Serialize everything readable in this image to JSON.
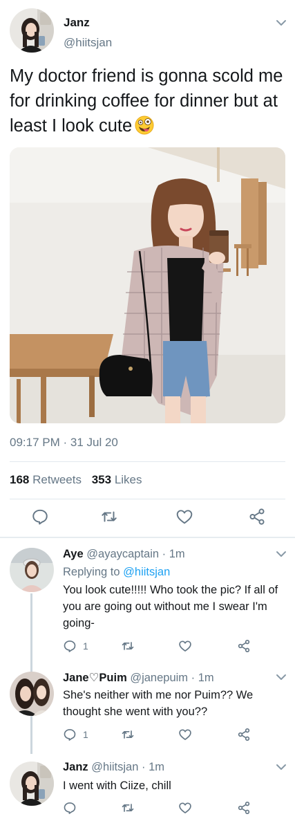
{
  "main_tweet": {
    "display_name": "Janz",
    "handle": "@hiitsjan",
    "text": "My doctor friend is gonna scold me for drinking coffee for dinner but at least I look cute",
    "emoji": "zany-face-emoji",
    "photo": "photo of woman in plaid jacket holding a coffee cup",
    "timestamp": "09:17 PM · 31 Jul 20",
    "retweets_count": "168",
    "retweets_label": "Retweets",
    "likes_count": "353",
    "likes_label": "Likes",
    "icons": [
      "reply-icon",
      "retweet-icon",
      "like-icon",
      "share-icon"
    ]
  },
  "replies": [
    {
      "display_name": "Aye",
      "handle": "@ayaycaptain",
      "time": "· 1m",
      "replying_label": "Replying to",
      "replying_to": "@hiitsjan",
      "text": "You look cute!!!!! Who took the pic? If all of you are going out without me I swear I'm going-",
      "reply_count": "1"
    },
    {
      "display_name": "Jane♡Puim",
      "handle": "@janepuim",
      "time": "· 1m",
      "text": "She's neither with me nor Puim?? We thought she went with you??",
      "reply_count": "1"
    },
    {
      "display_name": "Janz",
      "handle": "@hiitsjan",
      "time": "· 1m",
      "text": "I went with Ciize, chill",
      "reply_count": ""
    }
  ],
  "colors": {
    "accent": "#1da1f2",
    "text": "#14171a",
    "secondary": "#657786",
    "divider": "#e1e8ed"
  }
}
